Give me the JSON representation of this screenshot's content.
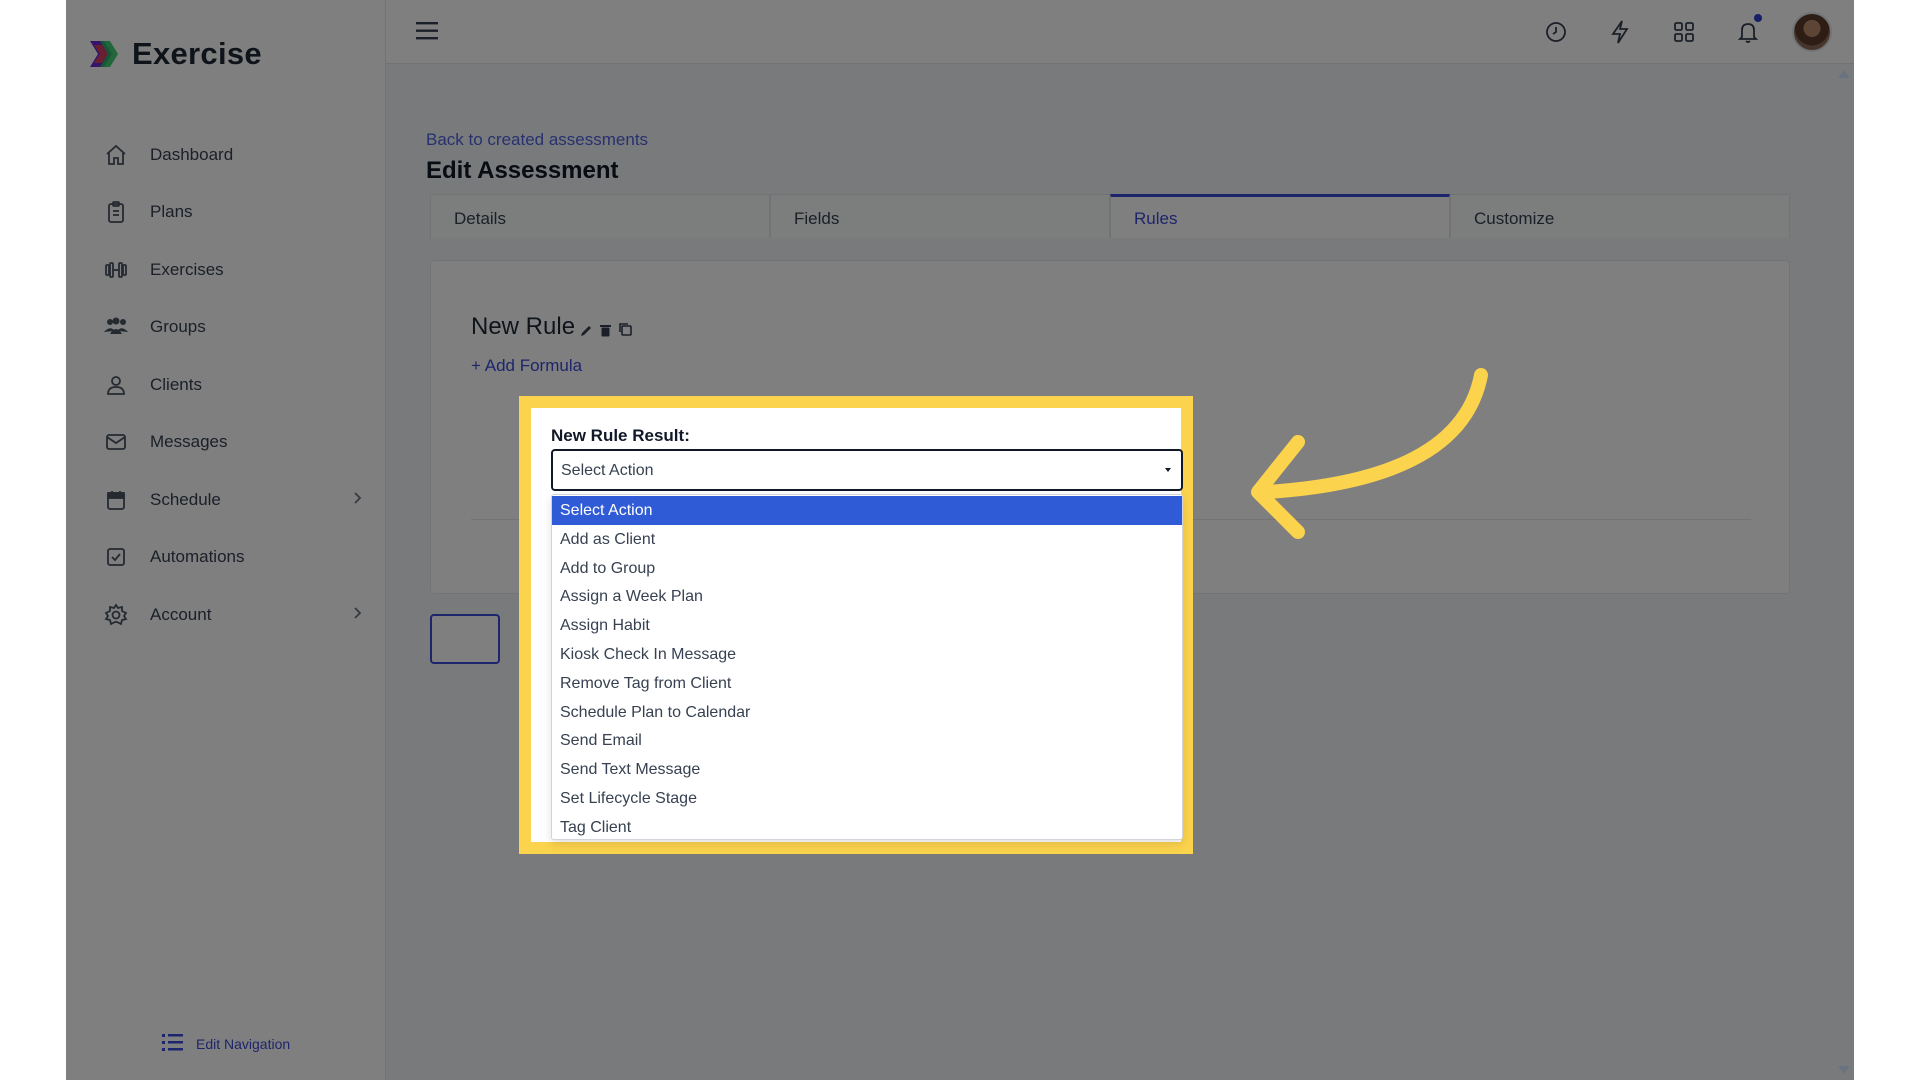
{
  "app": {
    "name": "Exercise"
  },
  "sidebar": {
    "items": [
      {
        "label": "Dashboard",
        "icon": "home-icon"
      },
      {
        "label": "Plans",
        "icon": "clipboard-icon"
      },
      {
        "label": "Exercises",
        "icon": "dumbbell-icon"
      },
      {
        "label": "Groups",
        "icon": "users-icon"
      },
      {
        "label": "Clients",
        "icon": "user-icon"
      },
      {
        "label": "Messages",
        "icon": "envelope-icon"
      },
      {
        "label": "Schedule",
        "icon": "calendar-icon",
        "has_submenu": true
      },
      {
        "label": "Automations",
        "icon": "checkbox-icon"
      },
      {
        "label": "Account",
        "icon": "gear-icon",
        "has_submenu": true
      }
    ],
    "edit_navigation": "Edit Navigation"
  },
  "topbar": {
    "icons": [
      "clock-icon",
      "lightning-icon",
      "grid-icon",
      "bell-icon"
    ],
    "notification_dot_color": "#2f3ecf"
  },
  "main": {
    "back_link": "Back to created assessments",
    "title": "Edit Assessment",
    "tabs": [
      {
        "label": "Details",
        "active": false
      },
      {
        "label": "Fields",
        "active": false
      },
      {
        "label": "Rules",
        "active": true
      },
      {
        "label": "Customize",
        "active": false
      }
    ],
    "rule": {
      "title": "New Rule",
      "actions": [
        "pencil-icon",
        "trash-icon",
        "copy-icon"
      ],
      "add_formula": "Add Formula",
      "result_label": "New Rule Result:",
      "select_value": "Select Action",
      "options": [
        "Select Action",
        "Add as Client",
        "Add to Group",
        "Assign a Week Plan",
        "Assign Habit",
        "Kiosk Check In Message",
        "Remove Tag from Client",
        "Schedule Plan to Calendar",
        "Send Email",
        "Send Text Message",
        "Set Lifecycle Stage",
        "Tag Client"
      ],
      "selected_option_index": 0
    }
  },
  "colors": {
    "accent": "#3b4bd8",
    "highlight": "#fcd34d",
    "selected_option": "#2f5bd7"
  }
}
